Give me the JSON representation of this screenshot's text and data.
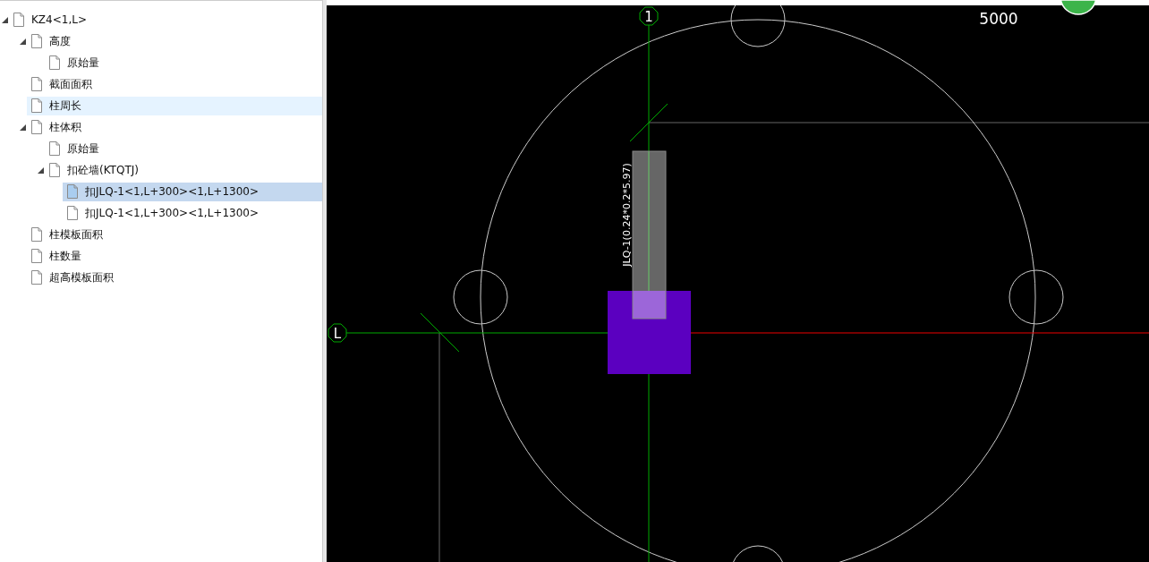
{
  "tree": [
    {
      "label": "KZ4<1,L>",
      "expanded": true,
      "selected": false,
      "hovered": false,
      "children": [
        {
          "label": "高度",
          "expanded": true,
          "selected": false,
          "hovered": false,
          "children": [
            {
              "label": "原始量",
              "selected": false,
              "hovered": false
            }
          ]
        },
        {
          "label": "截面面积",
          "selected": false,
          "hovered": false
        },
        {
          "label": "柱周长",
          "selected": false,
          "hovered": true
        },
        {
          "label": "柱体积",
          "expanded": true,
          "selected": false,
          "hovered": false,
          "children": [
            {
              "label": "原始量",
              "selected": false,
              "hovered": false
            },
            {
              "label": "扣砼墙(KTQTJ)",
              "expanded": true,
              "selected": false,
              "hovered": false,
              "children": [
                {
                  "label": "扣JLQ-1<1,L+300><1,L+1300>",
                  "selected": true,
                  "hovered": false
                },
                {
                  "label": "扣JLQ-1<1,L+300><1,L+1300>",
                  "selected": false,
                  "hovered": false
                }
              ]
            }
          ]
        },
        {
          "label": "柱模板面积",
          "selected": false,
          "hovered": false
        },
        {
          "label": "柱数量",
          "selected": false,
          "hovered": false
        },
        {
          "label": "超高模板面积",
          "selected": false,
          "hovered": false
        }
      ]
    }
  ],
  "canvas": {
    "vertical_axis_label": "1",
    "horizontal_axis_label": "L",
    "dimension": "5000",
    "wall_label": "JLQ-1(0.24*0.2*5.97)"
  }
}
